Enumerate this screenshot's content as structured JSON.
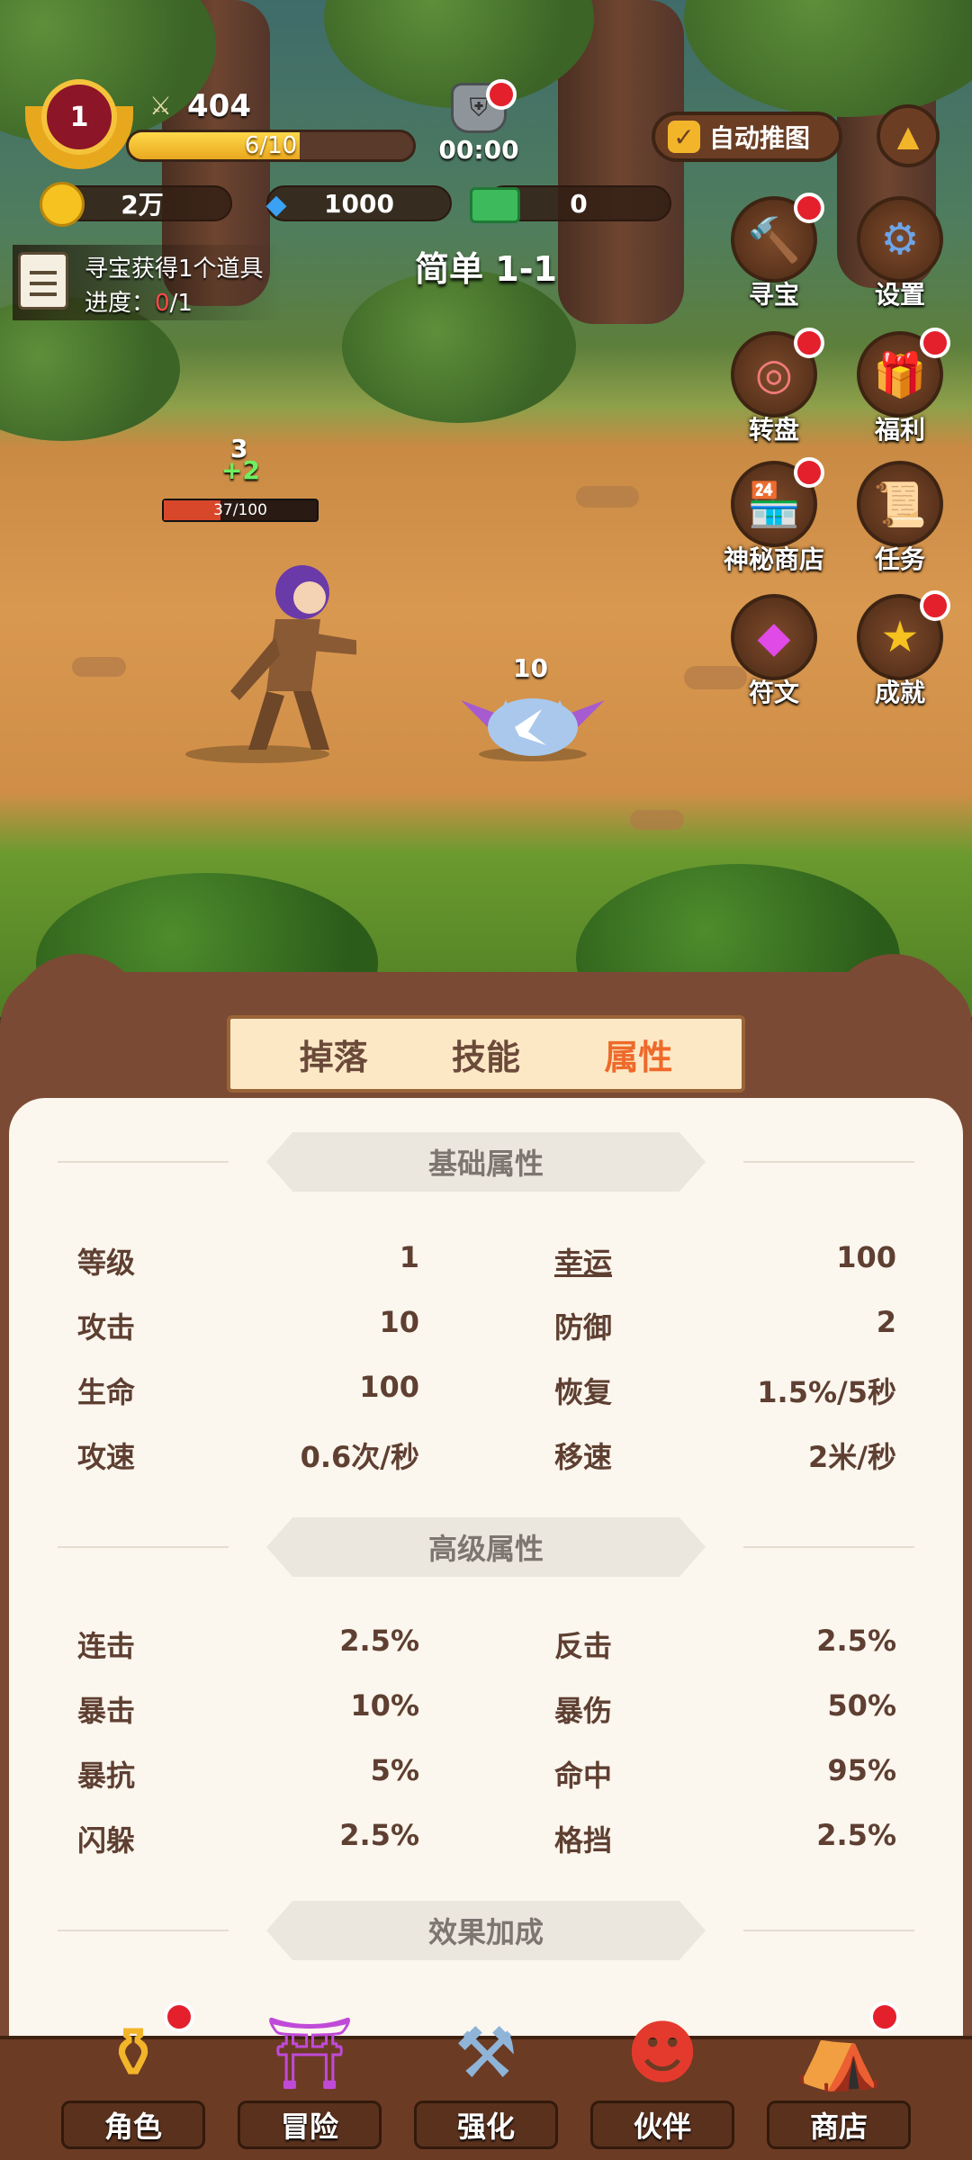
{
  "hud": {
    "level": "1",
    "power": "404",
    "exp_text": "6/10",
    "exp_fraction": 0.6,
    "timer": "00:00",
    "auto_label": "自动推图",
    "gold": "2万",
    "diamond": "1000",
    "cash": "0"
  },
  "quest": {
    "title": "寻宝获得1个道具",
    "progress_label": "进度：",
    "progress_current": "0",
    "progress_total": "/1"
  },
  "stage": "简单 1-1",
  "side_buttons": [
    {
      "label": "寻宝",
      "icon": "hammer-icon"
    },
    {
      "label": "设置",
      "icon": "gear-icon"
    },
    {
      "label": "转盘",
      "icon": "wheel-icon"
    },
    {
      "label": "福利",
      "icon": "gift-icon"
    },
    {
      "label": "神秘商店",
      "icon": "shop-icon"
    },
    {
      "label": "任务",
      "icon": "scroll-icon"
    },
    {
      "label": "符文",
      "icon": "gem-icon"
    },
    {
      "label": "成就",
      "icon": "star-icon"
    }
  ],
  "battle": {
    "hp_text": "37/100",
    "hp_fraction": 0.37,
    "float_top": "3",
    "float_heal": "+2",
    "enemy_damage": "10"
  },
  "tabs": [
    {
      "label": "掉落",
      "active": false
    },
    {
      "label": "技能",
      "active": false
    },
    {
      "label": "属性",
      "active": true
    }
  ],
  "sections": {
    "basic": "基础属性",
    "advanced": "高级属性",
    "bonus": "效果加成"
  },
  "basic_stats": [
    {
      "k": "等级",
      "v": "1"
    },
    {
      "k": "幸运",
      "v": "100"
    },
    {
      "k": "攻击",
      "v": "10"
    },
    {
      "k": "防御",
      "v": "2"
    },
    {
      "k": "生命",
      "v": "100"
    },
    {
      "k": "恢复",
      "v": "1.5%/5秒"
    },
    {
      "k": "攻速",
      "v": "0.6次/秒"
    },
    {
      "k": "移速",
      "v": "2米/秒"
    }
  ],
  "advanced_stats": [
    {
      "k": "连击",
      "v": "2.5%"
    },
    {
      "k": "反击",
      "v": "2.5%"
    },
    {
      "k": "暴击",
      "v": "10%"
    },
    {
      "k": "暴伤",
      "v": "50%"
    },
    {
      "k": "暴抗",
      "v": "5%"
    },
    {
      "k": "命中",
      "v": "95%"
    },
    {
      "k": "闪躲",
      "v": "2.5%"
    },
    {
      "k": "格挡",
      "v": "2.5%"
    }
  ],
  "nav": [
    {
      "label": "角色",
      "icon": "gold-pot-icon"
    },
    {
      "label": "冒险",
      "icon": "portal-icon"
    },
    {
      "label": "强化",
      "icon": "anvil-icon"
    },
    {
      "label": "伙伴",
      "icon": "companion-icon"
    },
    {
      "label": "商店",
      "icon": "market-stall-icon"
    }
  ]
}
